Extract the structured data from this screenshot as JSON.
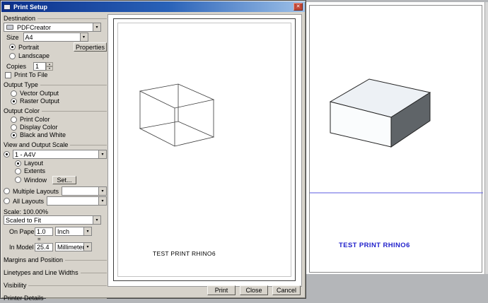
{
  "titlebar": {
    "title": "Print Setup"
  },
  "icons": {
    "dropdown": "▾",
    "spin_up": "▴",
    "spin_down": "▾",
    "close": "✕"
  },
  "destination": {
    "header": "Destination",
    "printer_value": "PDFCreator",
    "size_label": "Size",
    "size_value": "A4",
    "portrait_label": "Portrait",
    "landscape_label": "Landscape",
    "properties_label": "Properties",
    "copies_label": "Copies",
    "copies_value": "1",
    "print_to_file_label": "Print To File"
  },
  "output_type": {
    "header": "Output Type",
    "vector_label": "Vector Output",
    "raster_label": "Raster Output"
  },
  "output_color": {
    "header": "Output Color",
    "print_color_label": "Print Color",
    "display_color_label": "Display Color",
    "black_white_label": "Black and White"
  },
  "view_scale": {
    "header": "View and Output Scale",
    "view_value": "1 - A4V",
    "layout_label": "Layout",
    "extents_label": "Extents",
    "window_label": "Window",
    "set_label": "Set...",
    "multiple_layouts_label": "Multiple Layouts",
    "all_layouts_label": "All Layouts",
    "scale_text": "Scale:  100.00%",
    "fit_value": "Scaled to Fit",
    "on_paper_label": "On Paper",
    "on_paper_value": "1.0",
    "on_paper_unit": "Inch",
    "equals": "=",
    "in_model_label": "In Model",
    "in_model_value": "25.4",
    "in_model_unit": "Millimeter"
  },
  "sections": [
    "Margins and Position",
    "Linetypes and Line Widths",
    "Visibility",
    "Printer Details"
  ],
  "preview": {
    "caption": "TEST PRINT RHINO6"
  },
  "footer": {
    "print_label": "Print",
    "close_label": "Close",
    "cancel_label": "Cancel"
  },
  "pdf_window": {
    "caption": "TEST PRINT RHINO6"
  }
}
